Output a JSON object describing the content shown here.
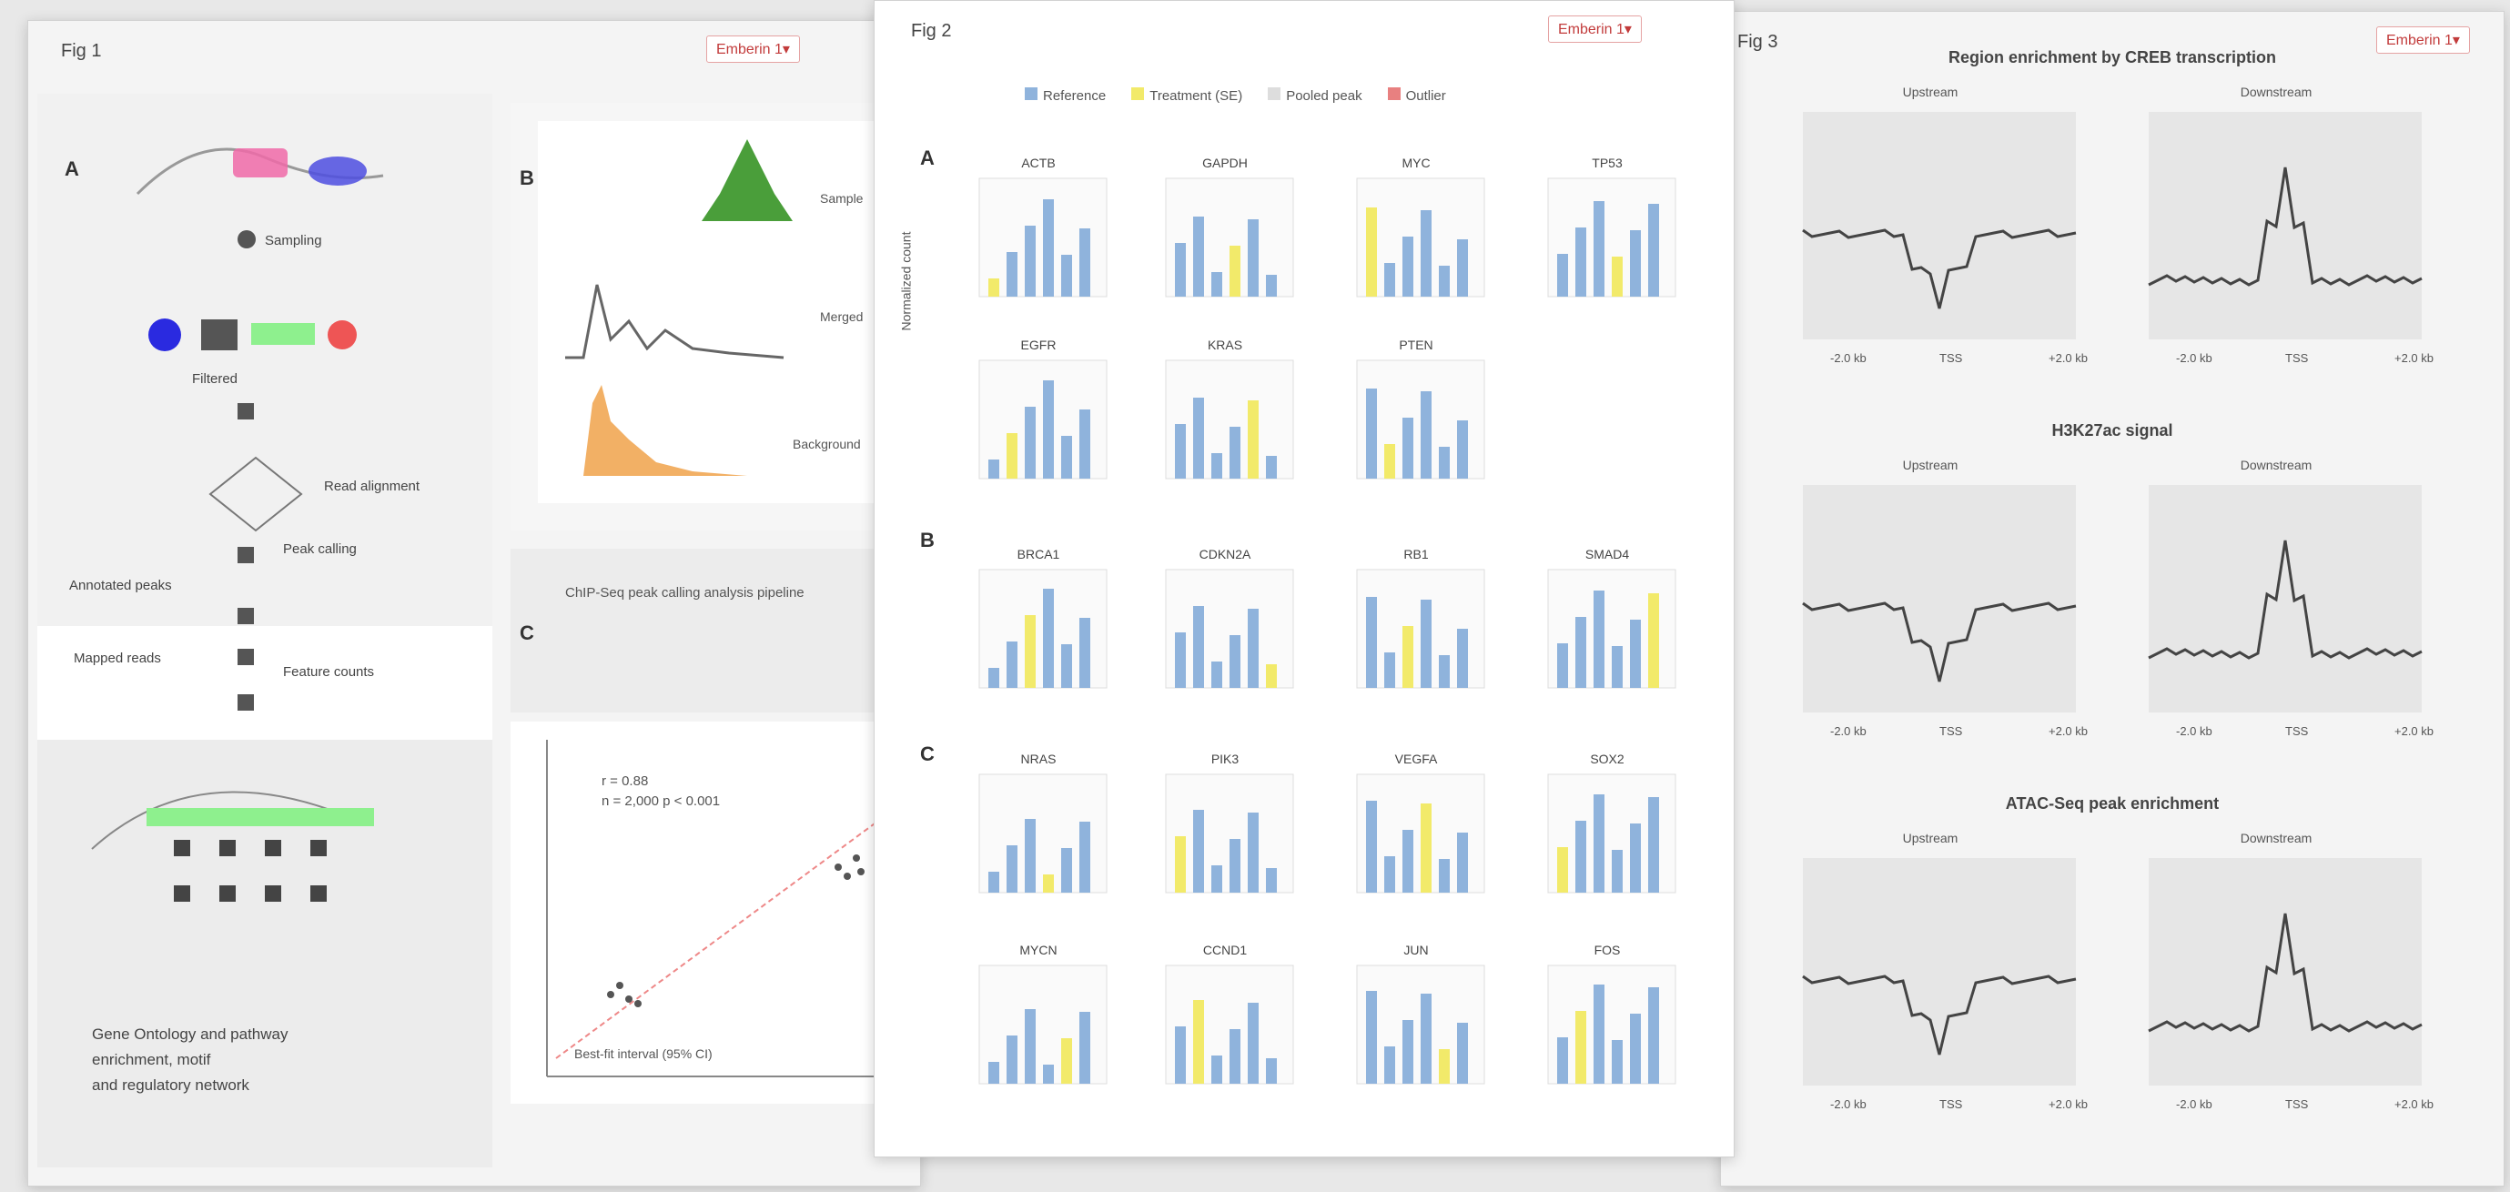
{
  "windows": {
    "fig1": {
      "title": "Fig 1",
      "button": "Emberin 1▾",
      "panel_labels": [
        "A",
        "B",
        "C"
      ]
    },
    "fig2": {
      "title": "Fig 2",
      "button": "Emberin 1▾"
    },
    "fig3": {
      "title": "Fig 3",
      "button": "Emberin 1▾"
    }
  },
  "fig1": {
    "pipeline_labels": [
      "Sampling",
      "Filtered",
      "Read alignment",
      "Peak calling",
      "Annotated peaks",
      "Mapped reads",
      "Feature counts"
    ],
    "c_text": "ChIP-Seq peak calling analysis pipeline",
    "caption": [
      "Gene Ontology and pathway",
      "enrichment, motif",
      "and regulatory network"
    ],
    "hist_labels": [
      "Sample",
      "Merged",
      "Background"
    ],
    "scatter_stats": [
      "r = 0.88",
      "n = 2,000  p < 0.001"
    ],
    "scatter_legend": "Best-fit interval (95% CI)"
  },
  "fig2": {
    "legend": [
      {
        "label": "Reference",
        "color": "#8fb3dc"
      },
      {
        "label": "Treatment (SE)",
        "color": "#f2ea6a"
      },
      {
        "label": "Pooled peak",
        "color": "#dddddd"
      },
      {
        "label": "Outlier",
        "color": "#e88080"
      }
    ],
    "row_labels": [
      "A",
      "B",
      "C"
    ],
    "row_axis": "Normalized count",
    "titles_a1": [
      "ACTB",
      "GAPDH",
      "MYC",
      "TP53"
    ],
    "titles_a2": [
      "EGFR",
      "KRAS",
      "PTEN"
    ],
    "titles_b": [
      "BRCA1",
      "CDKN2A",
      "RB1",
      "SMAD4"
    ],
    "titles_c1": [
      "NRAS",
      "PIK3",
      "VEGFA",
      "SOX2"
    ],
    "titles_c2": [
      "MYCN",
      "CCND1",
      "JUN",
      "FOS"
    ]
  },
  "fig3": {
    "sections": [
      {
        "title": "Region enrichment by CREB transcription",
        "subtitles": [
          "Upstream",
          "Downstream"
        ]
      },
      {
        "title": "H3K27ac signal",
        "subtitles": [
          "Upstream",
          "Downstream"
        ]
      },
      {
        "title": "ATAC-Seq peak enrichment",
        "subtitles": [
          "Upstream",
          "Downstream"
        ]
      }
    ],
    "x_ticks": [
      "-2.0 kb",
      "TSS",
      "+2.0 kb"
    ]
  }
}
